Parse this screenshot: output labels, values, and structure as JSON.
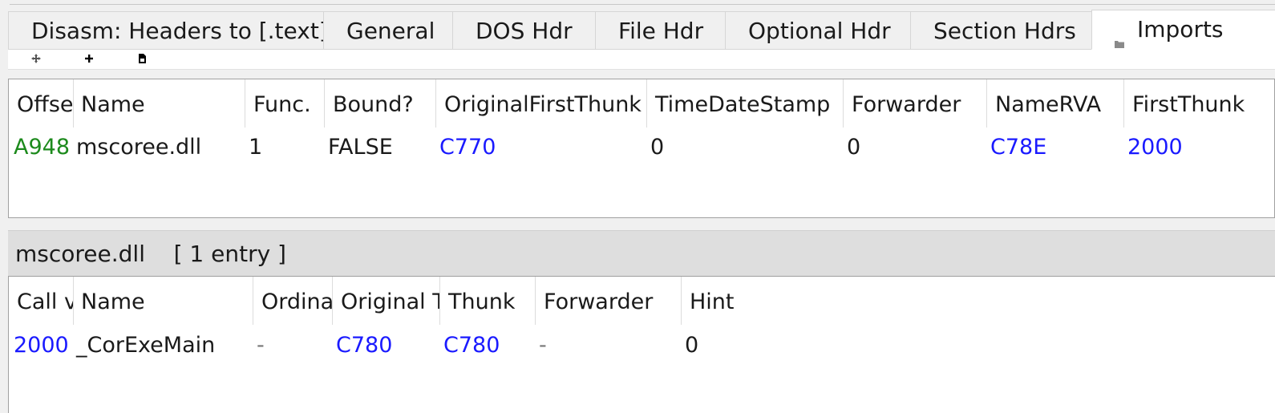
{
  "tabs": [
    {
      "label": "Disasm: Headers to [.text]",
      "active": false
    },
    {
      "label": "General",
      "active": false
    },
    {
      "label": "DOS Hdr",
      "active": false
    },
    {
      "label": "File Hdr",
      "active": false
    },
    {
      "label": "Optional Hdr",
      "active": false
    },
    {
      "label": "Section Hdrs",
      "active": false
    },
    {
      "label": "Imports",
      "active": true,
      "icon": "folder-icon"
    }
  ],
  "toolbar": {
    "move_icon": "move-icon",
    "add_icon": "plus-icon",
    "save_icon": "save-icon"
  },
  "imports_table": {
    "columns": [
      "Offset",
      "Name",
      "Func.",
      "Bound?",
      "OriginalFirstThunk",
      "TimeDateStamp",
      "Forwarder",
      "NameRVA",
      "FirstThunk"
    ],
    "rows": [
      {
        "offset": "A948",
        "name": "mscoree.dll",
        "func": "1",
        "bound": "FALSE",
        "original_first_thunk": "C770",
        "time_date_stamp": "0",
        "forwarder": "0",
        "name_rva": "C78E",
        "first_thunk": "2000"
      }
    ]
  },
  "section": {
    "title": "mscoree.dll    [ 1 entry ]"
  },
  "functions_table": {
    "columns": [
      "Call via",
      "Name",
      "Ordinal",
      "Original Thunk",
      "Thunk",
      "Forwarder",
      "Hint"
    ],
    "rows": [
      {
        "call_via": "2000",
        "name": "_CorExeMain",
        "ordinal": "-",
        "original_thunk": "C780",
        "thunk": "C780",
        "forwarder": "-",
        "hint": "0"
      }
    ]
  },
  "colors": {
    "offset_green": "#1c8a1c",
    "link_blue": "#1a1aff",
    "tab_bg": "#f0f0f0",
    "active_tab_bg": "#ffffff",
    "section_bar_bg": "#dedede"
  }
}
